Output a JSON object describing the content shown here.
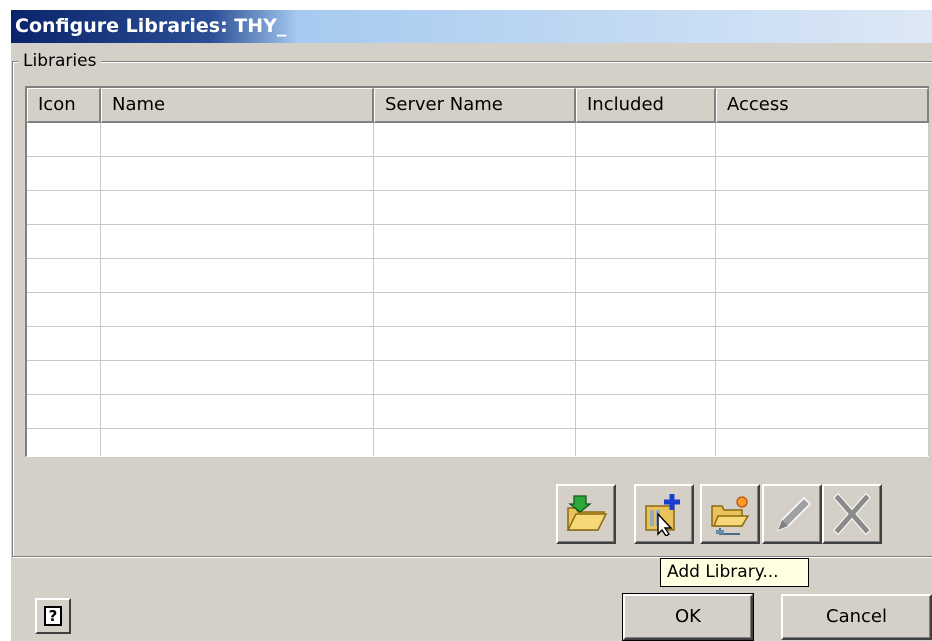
{
  "window": {
    "title": "Configure Libraries: THY_"
  },
  "libraries_group": {
    "label": "Libraries"
  },
  "table": {
    "columns": [
      "Icon",
      "Name",
      "Server Name",
      "Included",
      "Access"
    ],
    "rows": []
  },
  "toolbar": {
    "buttons": [
      {
        "icon": "open-library-folder-icon",
        "enabled": true
      },
      {
        "icon": "add-library-icon",
        "enabled": true
      },
      {
        "icon": "create-library-icon",
        "enabled": true
      },
      {
        "icon": "edit-library-icon",
        "enabled": false
      },
      {
        "icon": "remove-library-icon",
        "enabled": false
      }
    ],
    "tooltip": "Add Library..."
  },
  "footer": {
    "help_label": "?",
    "ok_label": "OK",
    "cancel_label": "Cancel"
  },
  "colors": {
    "title_bar": "#0a246a",
    "dialog_face": "#d4d0c8",
    "tooltip_bg": "#ffffe1"
  }
}
